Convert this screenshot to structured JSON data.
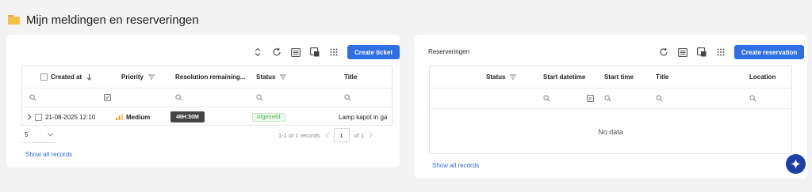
{
  "page": {
    "title": "Mijn meldingen en reserveringen"
  },
  "tickets": {
    "create_label": "Create ticket",
    "columns": {
      "created_at": "Created at",
      "priority": "Priority",
      "resolution": "Resolution remaining...",
      "status": "Status",
      "title": "Title"
    },
    "row": {
      "created": "21-08-2025 12:10",
      "priority": "Medium",
      "resolution": "46H:30M",
      "status": "Afgemeld",
      "title": "Lamp kapot in ga"
    },
    "pagination": {
      "page_size": "5",
      "range": "1-1 of 1 records",
      "current_page": "1",
      "total": "of 1"
    },
    "show_all": "Show all records"
  },
  "reservations": {
    "section_label": "Reserveringen",
    "create_label": "Create reservation",
    "columns": {
      "status": "Status",
      "start_datetime": "Start datetime",
      "start_time": "Start time",
      "title": "Title",
      "location": "Location"
    },
    "empty": "No data",
    "show_all": "Show all records"
  },
  "colors": {
    "primary": "#2f6fe4",
    "success": "#4cb050",
    "priority_medium": "#f39c12",
    "fab": "#1f3fa8"
  },
  "icons": [
    "folder-icon",
    "sort-icon",
    "refresh-icon",
    "table-settings-icon",
    "card-view-icon",
    "grid-icon",
    "filter-icon",
    "search-icon",
    "chevron-right-icon",
    "chevron-down-icon",
    "chevron-left-icon",
    "sparkle-icon",
    "priority-bars-icon"
  ]
}
